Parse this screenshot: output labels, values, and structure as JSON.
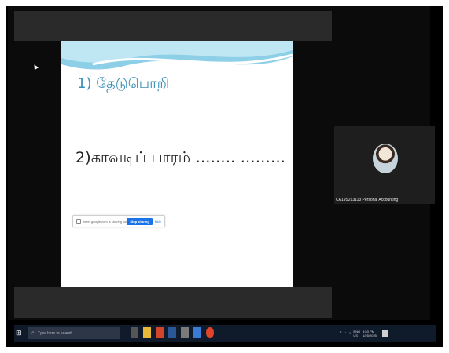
{
  "slide": {
    "line1": "1) தேடுபொறி",
    "line2": "2)காவடிப் பாரம் …….. ………"
  },
  "share_bar": {
    "message": "meet.google.com is sharing your screen.",
    "stop_label": "Stop sharing",
    "hide_label": "Hide"
  },
  "participant": {
    "name": "CA19S213113 Personal Accounting"
  },
  "taskbar": {
    "search_placeholder": "Type here to search",
    "language": "ENG",
    "language_sub": "US",
    "time": "4:53 PM",
    "date": "1/25/2025"
  },
  "colors": {
    "slide_title": "#3a8fb7",
    "stop_button": "#1a73e8",
    "taskbar": "#0f1a2a"
  }
}
